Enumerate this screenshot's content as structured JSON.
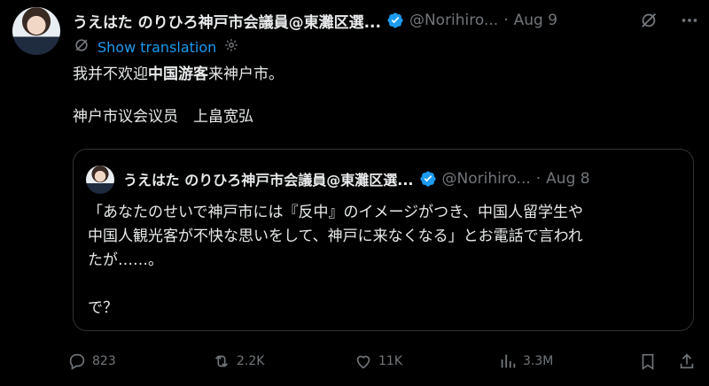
{
  "author": {
    "display_name": "うえはた のりひろ神戸市会議員@東灘区選...",
    "handle": "@Norihiro...",
    "date": "Aug 9"
  },
  "translate_label": "Show translation",
  "tweet": {
    "line1_pre": "我并不欢迎",
    "line1_bold": "中国游客",
    "line1_post": "来神户市。",
    "line2": "神户市议会议员　上畠宽弘"
  },
  "quoted": {
    "display_name": "うえはた のりひろ神戸市会議員@東灘区選...",
    "handle": "@Norihiro...",
    "date": "Aug 8",
    "line1": "「あなたのせいで神戸市には『反中』のイメージがつき、中国人留学生や",
    "line2": "中国人観光客が不快な思いをして、神戸に来なくなる」とお電話で言われ",
    "line3": "たが……。",
    "line4": "で？"
  },
  "metrics": {
    "replies": "823",
    "reposts": "2.2K",
    "likes": "11K",
    "views": "3.3M"
  },
  "colors": {
    "background": "#000000",
    "text": "#e7e9ea",
    "muted": "#71767b",
    "accent": "#1d9bf0",
    "border": "#2f3336"
  },
  "icons": [
    "verified-badge-icon",
    "grok-icon",
    "more-icon",
    "translate-icon",
    "settings-icon",
    "reply-icon",
    "repost-icon",
    "like-icon",
    "views-icon",
    "bookmark-icon",
    "share-icon"
  ]
}
